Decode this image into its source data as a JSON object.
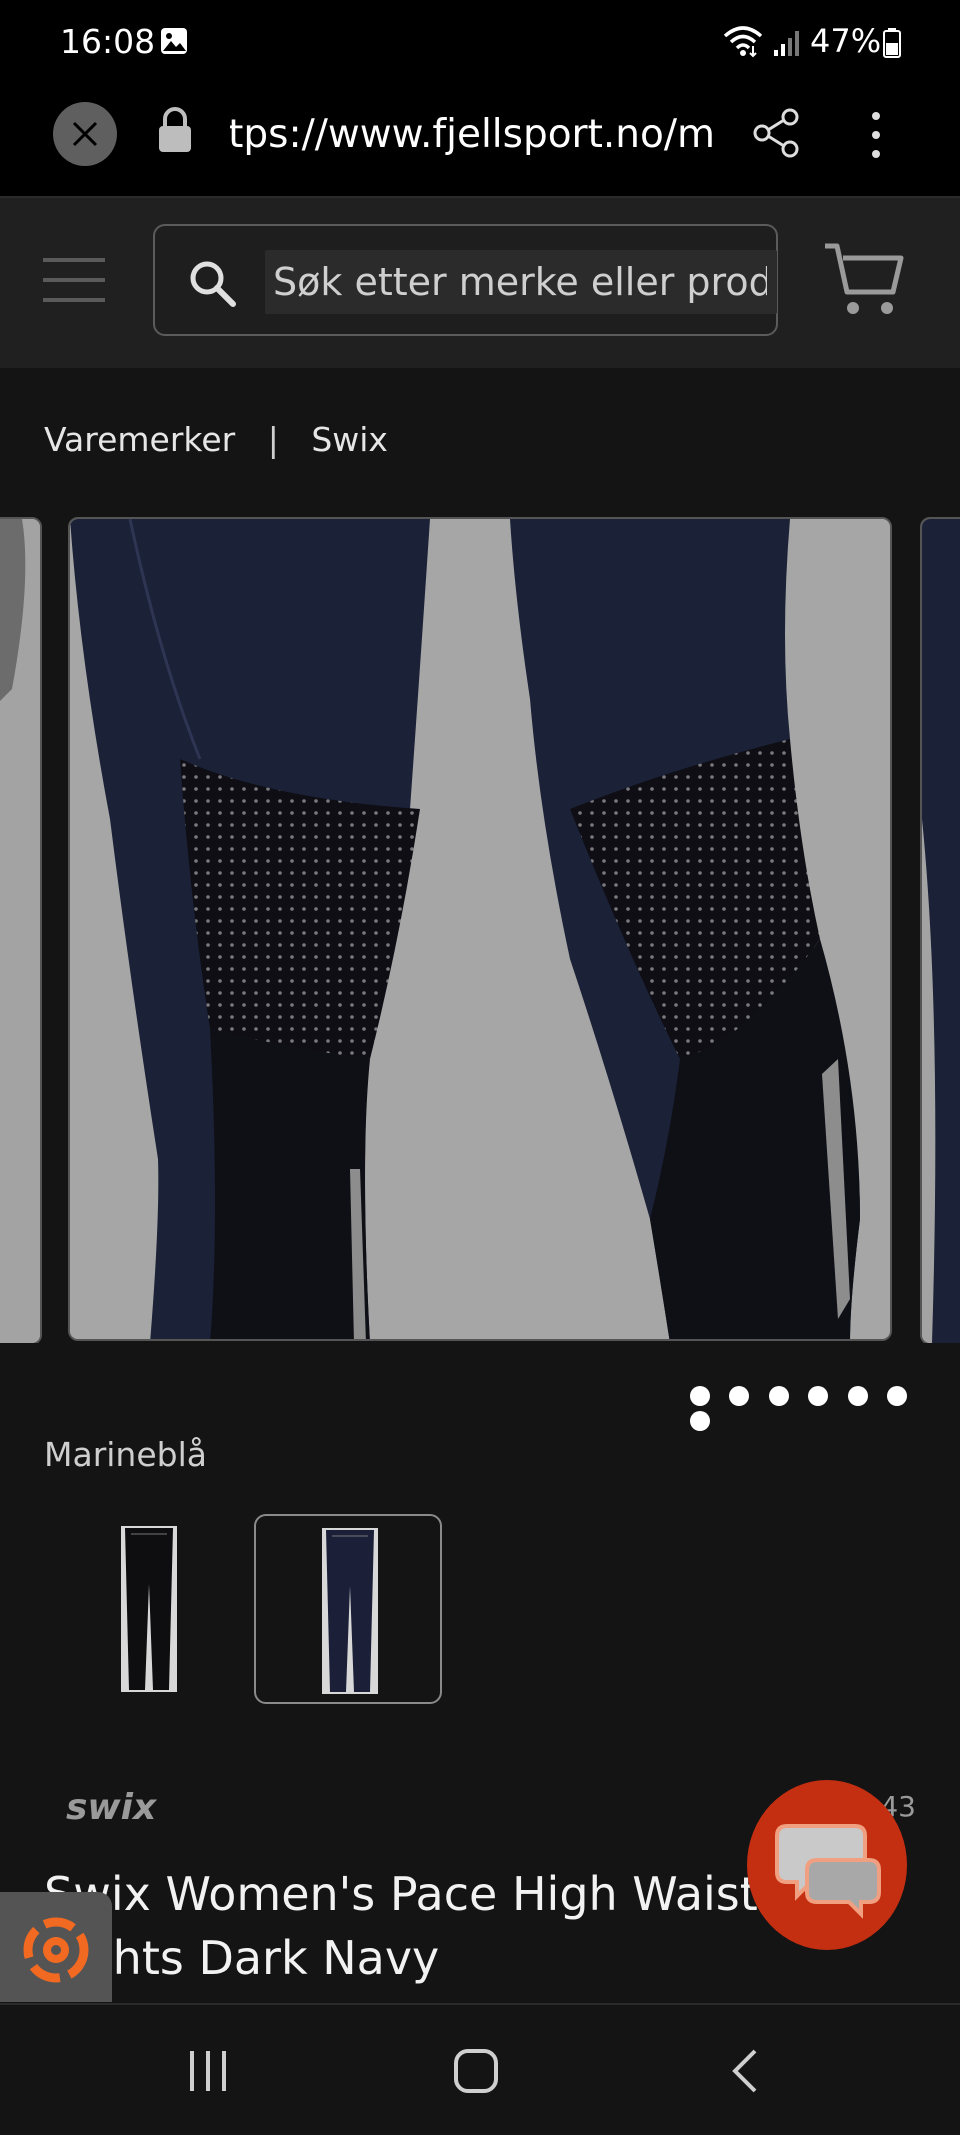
{
  "status_bar": {
    "time": "16:08",
    "battery": "47%"
  },
  "browser": {
    "url": "https://www.fjellsport.no/m",
    "close_icon": "close-icon",
    "lock_icon": "lock-icon",
    "share_icon": "share-icon",
    "menu_icon": "more-vert-icon"
  },
  "header": {
    "search_placeholder": "Søk etter merke eller produkt"
  },
  "breadcrumb": {
    "items": [
      "Varemerker",
      "Swix"
    ],
    "separator": "|"
  },
  "gallery": {
    "image_count": 7
  },
  "product": {
    "color_label": "Marineblå",
    "swatches": [
      "Black",
      "Dark Navy"
    ],
    "selected_swatch": 1,
    "brand": "swix",
    "sku": "143",
    "title": "Swix Women's Pace High Waist Tights Dark Navy"
  },
  "colors": {
    "background": "#141414",
    "header": "#202020",
    "chat_button": "#c42f12",
    "accessibility_icon": "#f26a21"
  }
}
